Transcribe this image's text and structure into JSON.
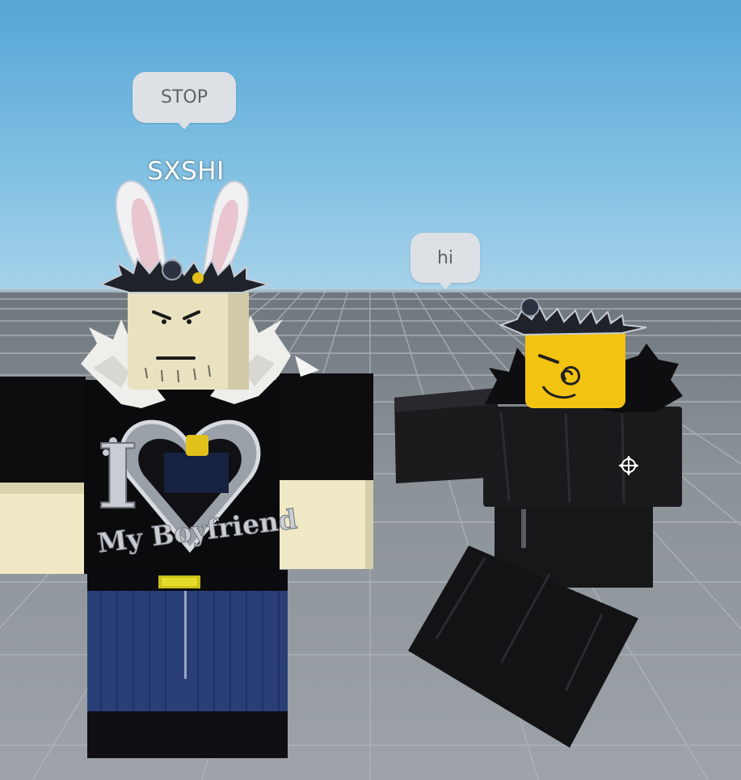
{
  "scene": {
    "sky_color": "#56a6d6",
    "ground_color": "#8c9399"
  },
  "players": [
    {
      "name": "SXSHI",
      "chat": "STOP",
      "shirt_text_line1": "I",
      "shirt_text_line2": "My Boyfriend",
      "accessories": [
        "bunny-ears",
        "spiked-crown",
        "fur-collar"
      ]
    },
    {
      "name": "",
      "chat": "hi",
      "accessories": [
        "spiked-crown",
        "black-fur-collar"
      ]
    }
  ],
  "cursor": {
    "icon": "move-cursor-icon"
  }
}
